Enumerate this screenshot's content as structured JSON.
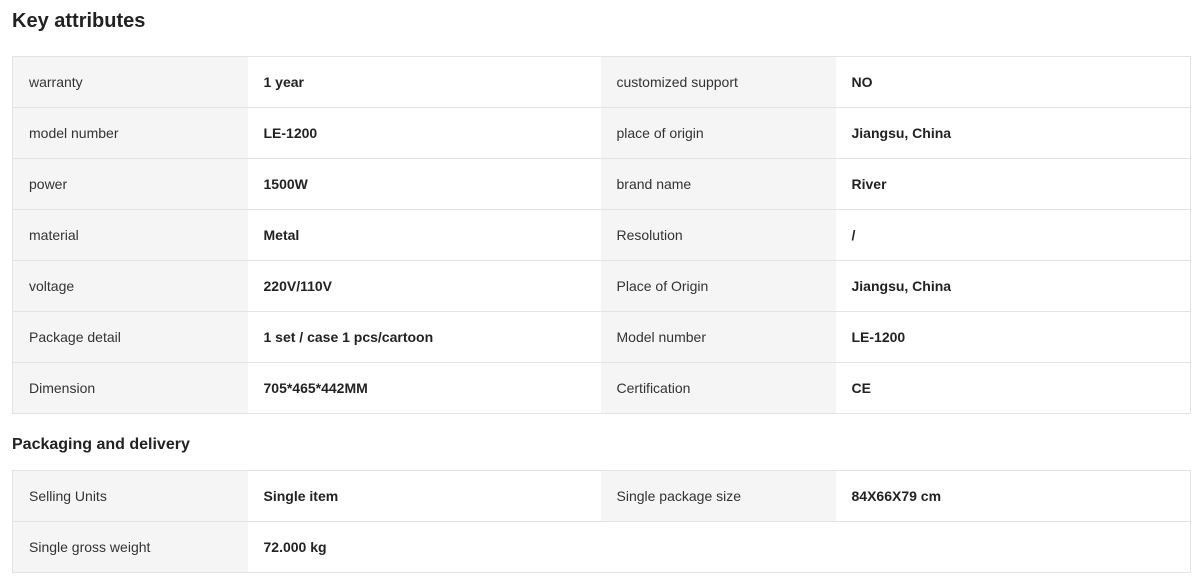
{
  "key_attributes": {
    "title": "Key attributes",
    "rows": [
      {
        "label1": "warranty",
        "value1": "1 year",
        "label2": "customized support",
        "value2": "NO"
      },
      {
        "label1": "model number",
        "value1": "LE-1200",
        "label2": "place of origin",
        "value2": "Jiangsu, China"
      },
      {
        "label1": "power",
        "value1": "1500W",
        "label2": "brand name",
        "value2": "River"
      },
      {
        "label1": "material",
        "value1": "Metal",
        "label2": "Resolution",
        "value2": "/"
      },
      {
        "label1": "voltage",
        "value1": "220V/110V",
        "label2": "Place of Origin",
        "value2": "Jiangsu, China"
      },
      {
        "label1": "Package detail",
        "value1": "1 set / case 1 pcs/cartoon",
        "label2": "Model number",
        "value2": "LE-1200"
      },
      {
        "label1": "Dimension",
        "value1": "705*465*442MM",
        "label2": "Certification",
        "value2": "CE"
      }
    ]
  },
  "packaging": {
    "title": "Packaging and delivery",
    "rows": [
      {
        "label1": "Selling Units",
        "value1": "Single item",
        "label2": "Single package size",
        "value2": "84X66X79 cm"
      },
      {
        "label1": "Single gross weight",
        "value1": "72.000 kg"
      }
    ]
  }
}
